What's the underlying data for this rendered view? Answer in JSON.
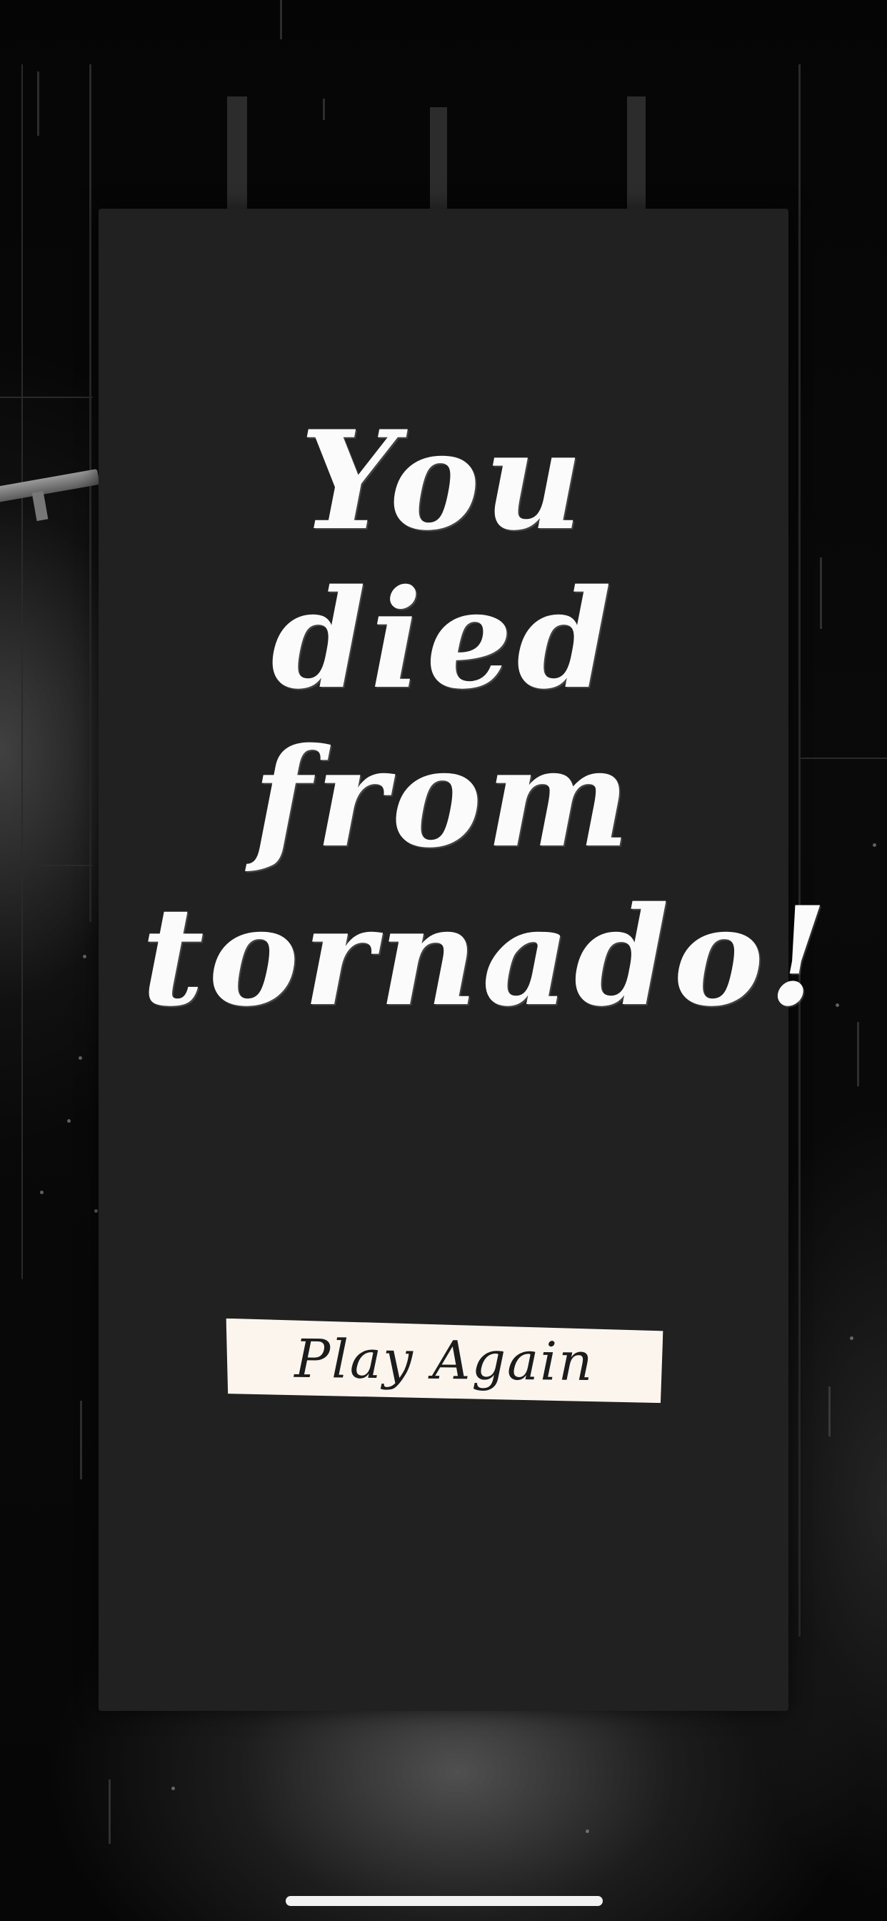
{
  "panel": {
    "message": "You died from tornado!",
    "button_label": "Play Again"
  },
  "colors": {
    "panel_background": "#212121",
    "message_text": "#fbfbfb",
    "button_background": "#fcf5ee",
    "button_text": "#1c1c1c",
    "scene_background": "#050505"
  },
  "icons": {
    "home_indicator": "home-indicator-bar"
  }
}
